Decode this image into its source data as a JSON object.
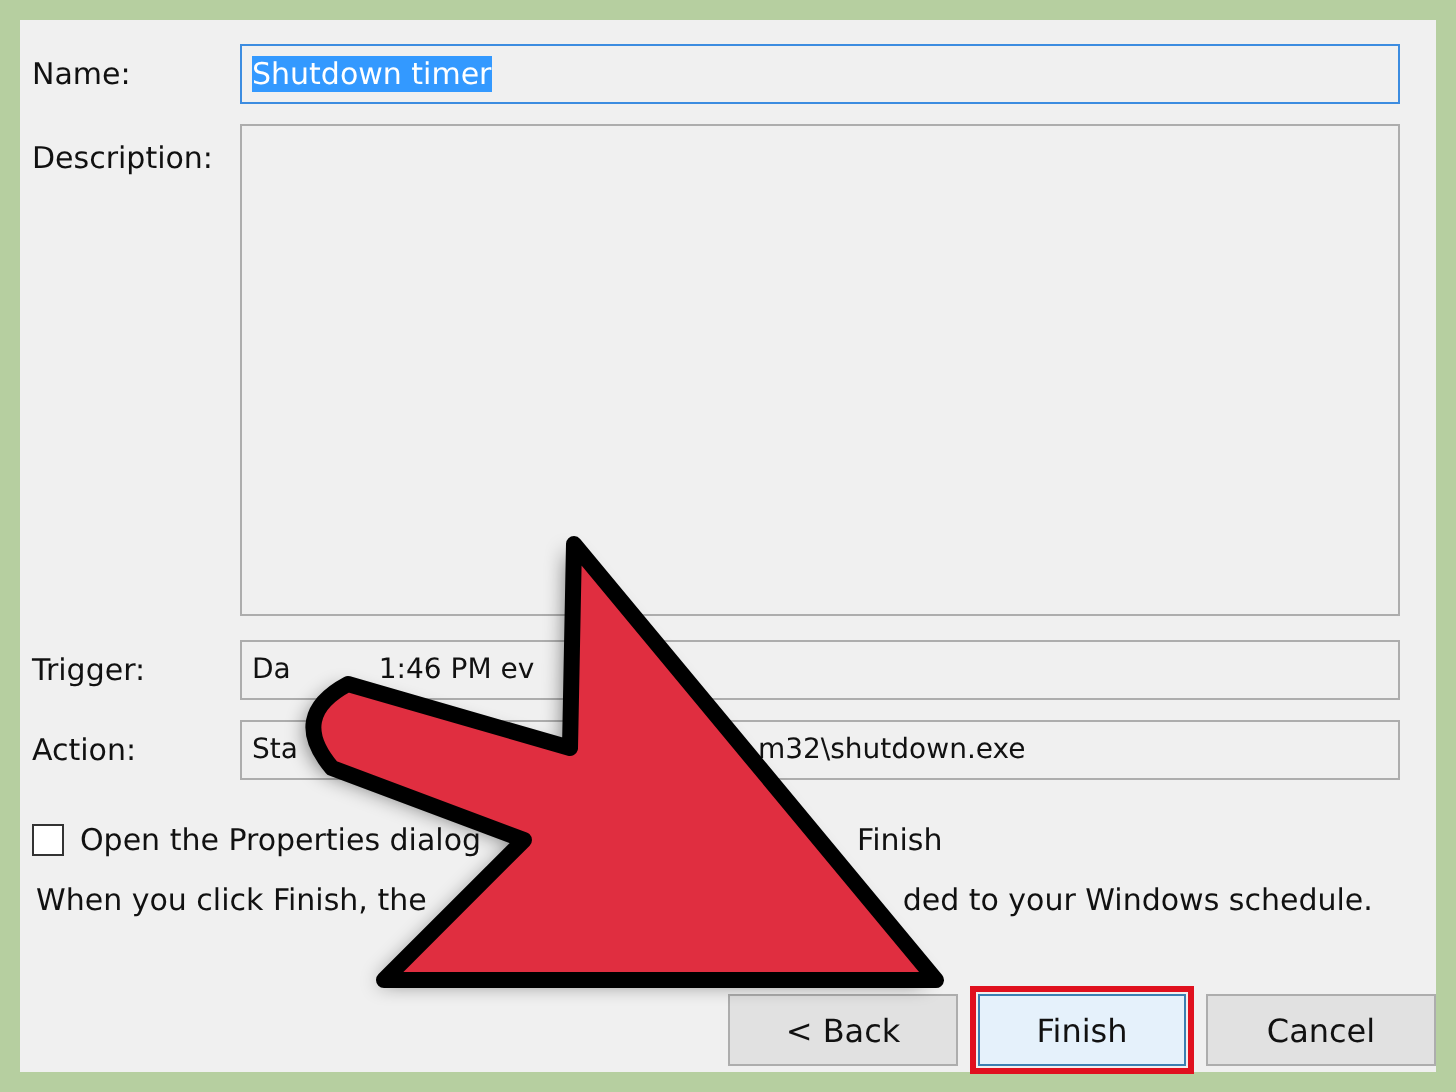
{
  "name_field": {
    "label": "Name:",
    "value": "Shutdown timer",
    "selected": true
  },
  "description_field": {
    "label": "Description:"
  },
  "trigger_field": {
    "label": "Trigger:",
    "value_parts": [
      "Da",
      "1:46 PM ev"
    ]
  },
  "action_field": {
    "label": "Action:",
    "value_parts": [
      "Sta",
      "m32\\shutdown.exe"
    ]
  },
  "open_properties": {
    "checked": false,
    "label_parts": [
      "Open the Properties dialog",
      "Finish"
    ]
  },
  "info_parts": [
    "When you click Finish, the",
    "ded to your Windows schedule."
  ],
  "buttons": [
    {
      "label": "< Back",
      "highlighted": false
    },
    {
      "label": "Finish",
      "highlighted": true
    },
    {
      "label": "Cancel",
      "highlighted": false
    }
  ]
}
